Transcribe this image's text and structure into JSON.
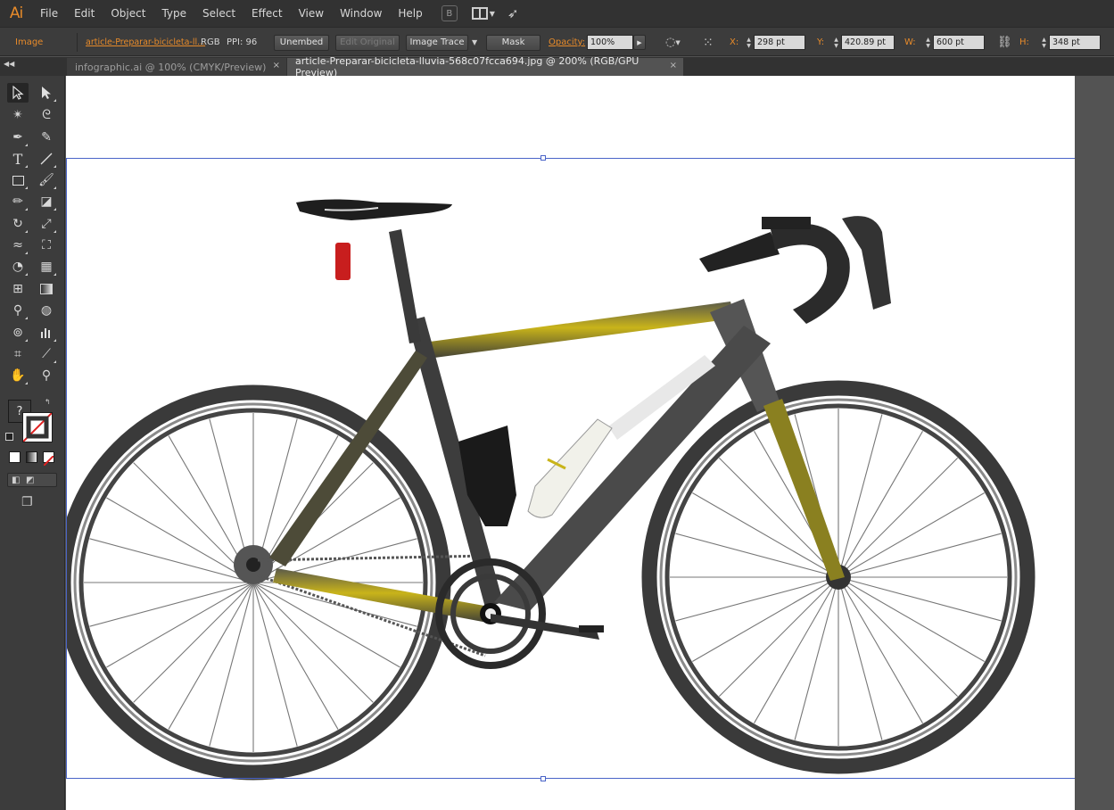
{
  "app": {
    "logo": "Ai",
    "menu": [
      "File",
      "Edit",
      "Object",
      "Type",
      "Select",
      "Effect",
      "View",
      "Window",
      "Help"
    ]
  },
  "control_bar": {
    "selection_type": "Image",
    "linked_file": "article-Preparar-bicicleta-ll...",
    "color_mode": "RGB",
    "ppi_label": "PPI: 96",
    "embed_button": "Unembed",
    "edit_original_button": "Edit Original",
    "image_trace_button": "Image Trace",
    "mask_button": "Mask",
    "opacity_label": "Opacity:",
    "opacity_value": "100%",
    "x_label": "X:",
    "x_value": "298 pt",
    "y_label": "Y:",
    "y_value": "420.89 pt",
    "w_label": "W:",
    "w_value": "600 pt",
    "h_label": "H:",
    "h_value": "348 pt"
  },
  "tabs": [
    {
      "label": "infographic.ai @ 100% (CMYK/Preview)",
      "close": "×",
      "active": false
    },
    {
      "label": "article-Preparar-bicicleta-lluvia-568c07fcca694.jpg @ 200% (RGB/GPU Preview)",
      "close": "×",
      "active": true
    }
  ],
  "toolbar": {
    "default_fill_stroke": "?",
    "colors": {
      "accent": "#e88b2a",
      "selection": "#4a64c8",
      "frame_yellow": "#a99a12"
    }
  },
  "icons": [
    "selection-tool-icon",
    "direct-selection-tool-icon",
    "magic-wand-tool-icon",
    "lasso-tool-icon",
    "pen-tool-icon",
    "curvature-tool-icon",
    "type-tool-icon",
    "line-tool-icon",
    "rectangle-tool-icon",
    "paintbrush-tool-icon",
    "pencil-tool-icon",
    "eraser-tool-icon",
    "rotate-tool-icon",
    "scale-tool-icon",
    "width-tool-icon",
    "free-transform-tool-icon",
    "shape-builder-tool-icon",
    "perspective-grid-tool-icon",
    "mesh-tool-icon",
    "gradient-tool-icon",
    "eyedropper-tool-icon",
    "blend-tool-icon",
    "symbol-sprayer-tool-icon",
    "column-graph-tool-icon",
    "artboard-tool-icon",
    "slice-tool-icon",
    "hand-tool-icon",
    "zoom-tool-icon"
  ]
}
